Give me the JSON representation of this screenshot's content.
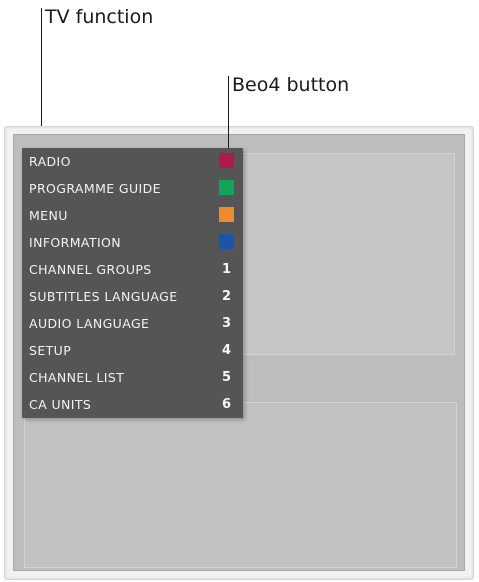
{
  "callouts": {
    "tv_function": "TV function",
    "beo4_button": "Beo4 button"
  },
  "menu": {
    "items": [
      {
        "label": "RADIO",
        "key_type": "color",
        "color": "#b0194f"
      },
      {
        "label": "PROGRAMME GUIDE",
        "key_type": "color",
        "color": "#0ea65a"
      },
      {
        "label": "MENU",
        "key_type": "color",
        "color": "#f08a2c"
      },
      {
        "label": "INFORMATION",
        "key_type": "color",
        "color": "#1a55a8"
      },
      {
        "label": "CHANNEL GROUPS",
        "key_type": "number",
        "key": "1"
      },
      {
        "label": "SUBTITLES LANGUAGE",
        "key_type": "number",
        "key": "2"
      },
      {
        "label": "AUDIO LANGUAGE",
        "key_type": "number",
        "key": "3"
      },
      {
        "label": "SETUP",
        "key_type": "number",
        "key": "4"
      },
      {
        "label": "CHANNEL LIST",
        "key_type": "number",
        "key": "5"
      },
      {
        "label": "CA UNITS",
        "key_type": "number",
        "key": "6"
      }
    ]
  }
}
